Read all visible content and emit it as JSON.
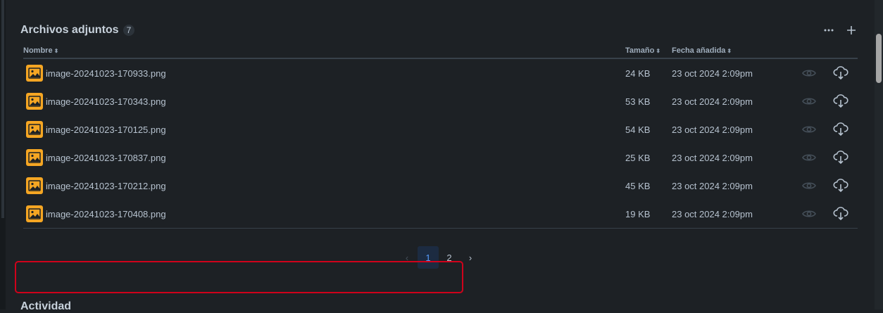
{
  "attachments": {
    "title": "Archivos adjuntos",
    "count": "7",
    "columns": {
      "name": "Nombre",
      "size": "Tamaño",
      "date": "Fecha añadida"
    },
    "files": [
      {
        "name": "image-20241023-170933.png",
        "size": "24 KB",
        "date": "23 oct 2024 2:09pm"
      },
      {
        "name": "image-20241023-170343.png",
        "size": "53 KB",
        "date": "23 oct 2024 2:09pm"
      },
      {
        "name": "image-20241023-170125.png",
        "size": "54 KB",
        "date": "23 oct 2024 2:09pm"
      },
      {
        "name": "image-20241023-170837.png",
        "size": "25 KB",
        "date": "23 oct 2024 2:09pm"
      },
      {
        "name": "image-20241023-170212.png",
        "size": "45 KB",
        "date": "23 oct 2024 2:09pm"
      },
      {
        "name": "image-20241023-170408.png",
        "size": "19 KB",
        "date": "23 oct 2024 2:09pm"
      }
    ]
  },
  "pagination": {
    "prev": "‹",
    "pages": [
      "1",
      "2"
    ],
    "next": "›",
    "current": "1"
  },
  "activity": {
    "title": "Actividad"
  },
  "icons": {
    "file": "image-file-icon",
    "view": "eye-icon",
    "download": "cloud-download-icon",
    "more": "more-icon",
    "add": "plus-icon"
  },
  "colors": {
    "background": "#1d2125",
    "file_icon": "#f5a623",
    "highlight": "#d0021b",
    "current_page": "#579dff"
  }
}
